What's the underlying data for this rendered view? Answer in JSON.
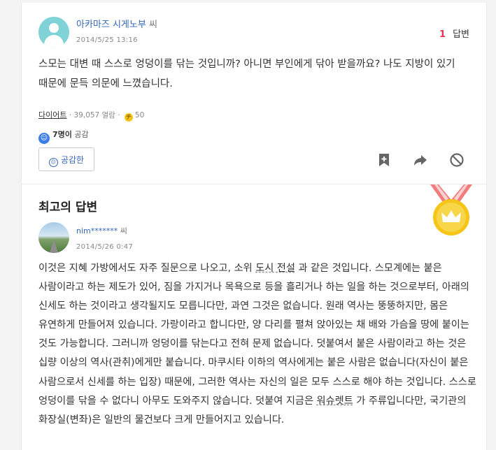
{
  "question": {
    "author_name": "아카마즈 시게노부",
    "author_suffix": " 씨",
    "date": "2014/5/25 13:16",
    "answer_count": "1",
    "answer_label": "답변",
    "text": "스모는 대변 때 스스로 엉덩이를 닦는 것입니까? 아니면 부인에게 닦아 받을까요? 나도 지방이 있기 때문에 문득 의문에 느꼈습니다.",
    "category": "다이어트",
    "views": " · 39,057 열람 · ",
    "coin_symbol": "チ",
    "coins": "50",
    "empathy_count": "7명이",
    "empathy_label": " 공감",
    "empathy_button": "공감한"
  },
  "best_answer": {
    "title": "최고의 답변",
    "author_name": "nim*******",
    "author_suffix": " 씨",
    "date": "2014/5/26 0:47",
    "text_1": "이것은 지혜 가방에서도 자주 질문으로 나오고, 소위 ",
    "link_1": "도시 전설",
    "text_2": " 과 같은 것입니다. 스모계에는 붙은 사람이라고 하는 제도가 있어, 짐을 가지거나 목욕으로 등을 흘리거나 하는 일을 하는 것으로부터, 아래의 신세도 하는 것이라고 생각될지도 모릅니다만, 과연 그것은 없습니다. 원래 역사는 뚱뚱하지만, 몸은 유연하게 만들어져 있습니다. 가랑이라고 합니다만, 양 다리를 펼쳐 앉아있는 채 배와 가슴을 땅에 붙이는 것도 가능합니다. 그러니까 엉덩이를 닦는다고 전혀 문제 없습니다. 덧붙여서 붙은 사람이라고 하는 것은 십량 이상의 역사(관취)에게만 붙습니다. 마쿠시타 이하의 역사에게는 붙은 사람은 없습니다(자신이 붙은 사람으로서 신세를 하는 입장) 때문에, 그러한 역사는 자신의 일은 모두 스스로 해야 하는 것입니다. 스스로 엉덩이를 닦을 수 없다니 아무도 도와주지 않습니다. 덧붙여 지금은 ",
    "link_2": "워슈렛트",
    "text_3": " 가 주류입니다만, 국기관의 화장실(변좌)은 일반의 물건보다 크게 만들어지고 있습니다."
  },
  "icons": [
    "bookmark-icon",
    "share-icon",
    "block-icon",
    "gold-medal-icon"
  ],
  "colors": {
    "link": "#3366bb",
    "answer_count": "#e0344c",
    "medal": "#f5c518",
    "ribbon": "#f07c7c",
    "empathy": "#3b7de9"
  }
}
